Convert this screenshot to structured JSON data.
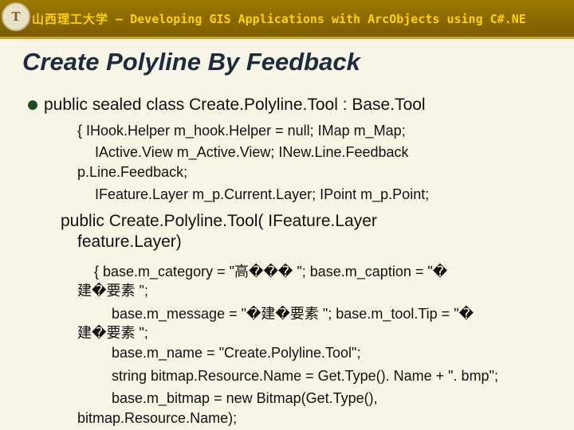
{
  "header": {
    "logo_text": "T",
    "university": "山西理工大学",
    "course": " – Developing GIS Applications with ArcObjects using C#.NE"
  },
  "slide": {
    "title": "Create Polyline By Feedback",
    "lines": [
      "public sealed class Create.Polyline.Tool : Base.Tool",
      "{   IHook.Helper m_hook.Helper = null;   IMap m_Map;",
      "IActive.View m_Active.View;   INew.Line.Feedback",
      "p.Line.Feedback;",
      "IFeature.Layer m_p.Current.Layer;   IPoint m_p.Point;",
      "public Create.Polyline.Tool( IFeature.Layer",
      "feature.Layer)",
      "{   base.m_category = \"高���  \";        base.m_caption = \"�",
      "建�要素 \";",
      "base.m_message = \"�建�要素 \";      base.m_tool.Tip = \"�",
      "建�要素 \";",
      "base.m_name = \"Create.Polyline.Tool\";",
      "string bitmap.Resource.Name = Get.Type(). Name + \". bmp\";",
      "base.m_bitmap = new Bitmap(Get.Type(),",
      "bitmap.Resource.Name);"
    ]
  }
}
